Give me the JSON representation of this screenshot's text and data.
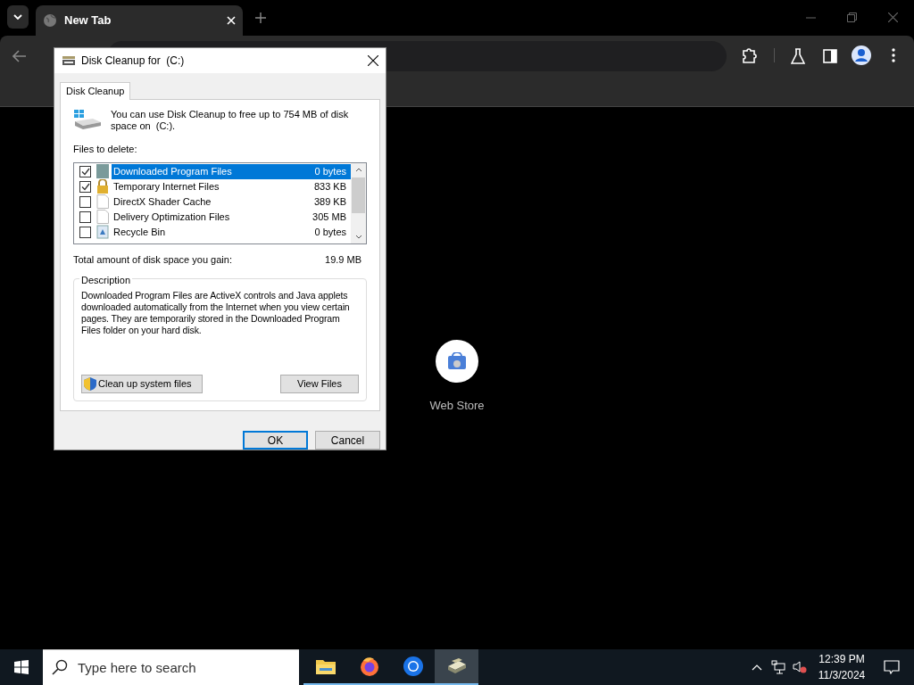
{
  "browser": {
    "tab": {
      "title": "New Tab",
      "selected": true
    },
    "shortcut": {
      "label": "Web Store"
    }
  },
  "dialog": {
    "title": "Disk Cleanup for  (C:)",
    "tabs": [
      {
        "label": "Disk Cleanup",
        "selected": true
      }
    ],
    "intro": "You can use Disk Cleanup to free up to 754 MB of disk space on  (C:).",
    "files_label": "Files to delete:",
    "files": [
      {
        "name": "Downloaded Program Files",
        "size": "0 bytes",
        "checked": true,
        "selected": true,
        "kind": "folder"
      },
      {
        "name": "Temporary Internet Files",
        "size": "833 KB",
        "checked": true,
        "selected": false,
        "kind": "lock"
      },
      {
        "name": "DirectX Shader Cache",
        "size": "389 KB",
        "checked": false,
        "selected": false,
        "kind": "file"
      },
      {
        "name": "Delivery Optimization Files",
        "size": "305 MB",
        "checked": false,
        "selected": false,
        "kind": "file"
      },
      {
        "name": "Recycle Bin",
        "size": "0 bytes",
        "checked": false,
        "selected": false,
        "kind": "bin"
      }
    ],
    "total_label": "Total amount of disk space you gain:",
    "total_value": "19.9 MB",
    "description_title": "Description",
    "description": "Downloaded Program Files are ActiveX controls and Java applets downloaded automatically from the Internet when you view certain pages. They are temporarily stored in the Downloaded Program Files folder on your hard disk.",
    "cleanup_button": "Clean up system files",
    "view_button": "View Files",
    "ok_button": "OK",
    "cancel_button": "Cancel"
  },
  "taskbar": {
    "search_placeholder": "Type here to search",
    "apps": [
      {
        "kind": "explorer",
        "selected": false
      },
      {
        "kind": "firefox",
        "selected": false
      },
      {
        "kind": "chrome",
        "selected": false
      },
      {
        "kind": "cleanup",
        "selected": true
      }
    ],
    "time": "12:39 PM",
    "date": "11/3/2024"
  }
}
